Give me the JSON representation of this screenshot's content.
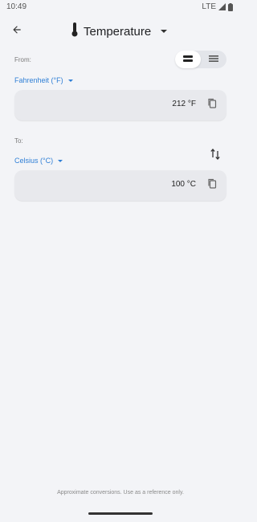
{
  "status": {
    "time": "10:49",
    "network": "LTE"
  },
  "header": {
    "title": "Temperature"
  },
  "from": {
    "label": "From:",
    "unit": "Fahrenheit (°F)",
    "value": "212 °F"
  },
  "to": {
    "label": "To:",
    "unit": "Celsius (°C)",
    "value": "100 °C"
  },
  "footer": {
    "note": "Approximate conversions. Use as a reference only."
  },
  "icons": {
    "back": "arrow-back-icon",
    "title": "thermometer-icon",
    "layout_toggle_1": "two-line-layout-icon",
    "layout_toggle_2": "list-layout-icon",
    "copy": "copy-icon",
    "swap": "swap-vertical-icon"
  },
  "colors": {
    "accent": "#2f7fd6",
    "background": "#f3f4f7",
    "box": "#e8e9ed"
  }
}
